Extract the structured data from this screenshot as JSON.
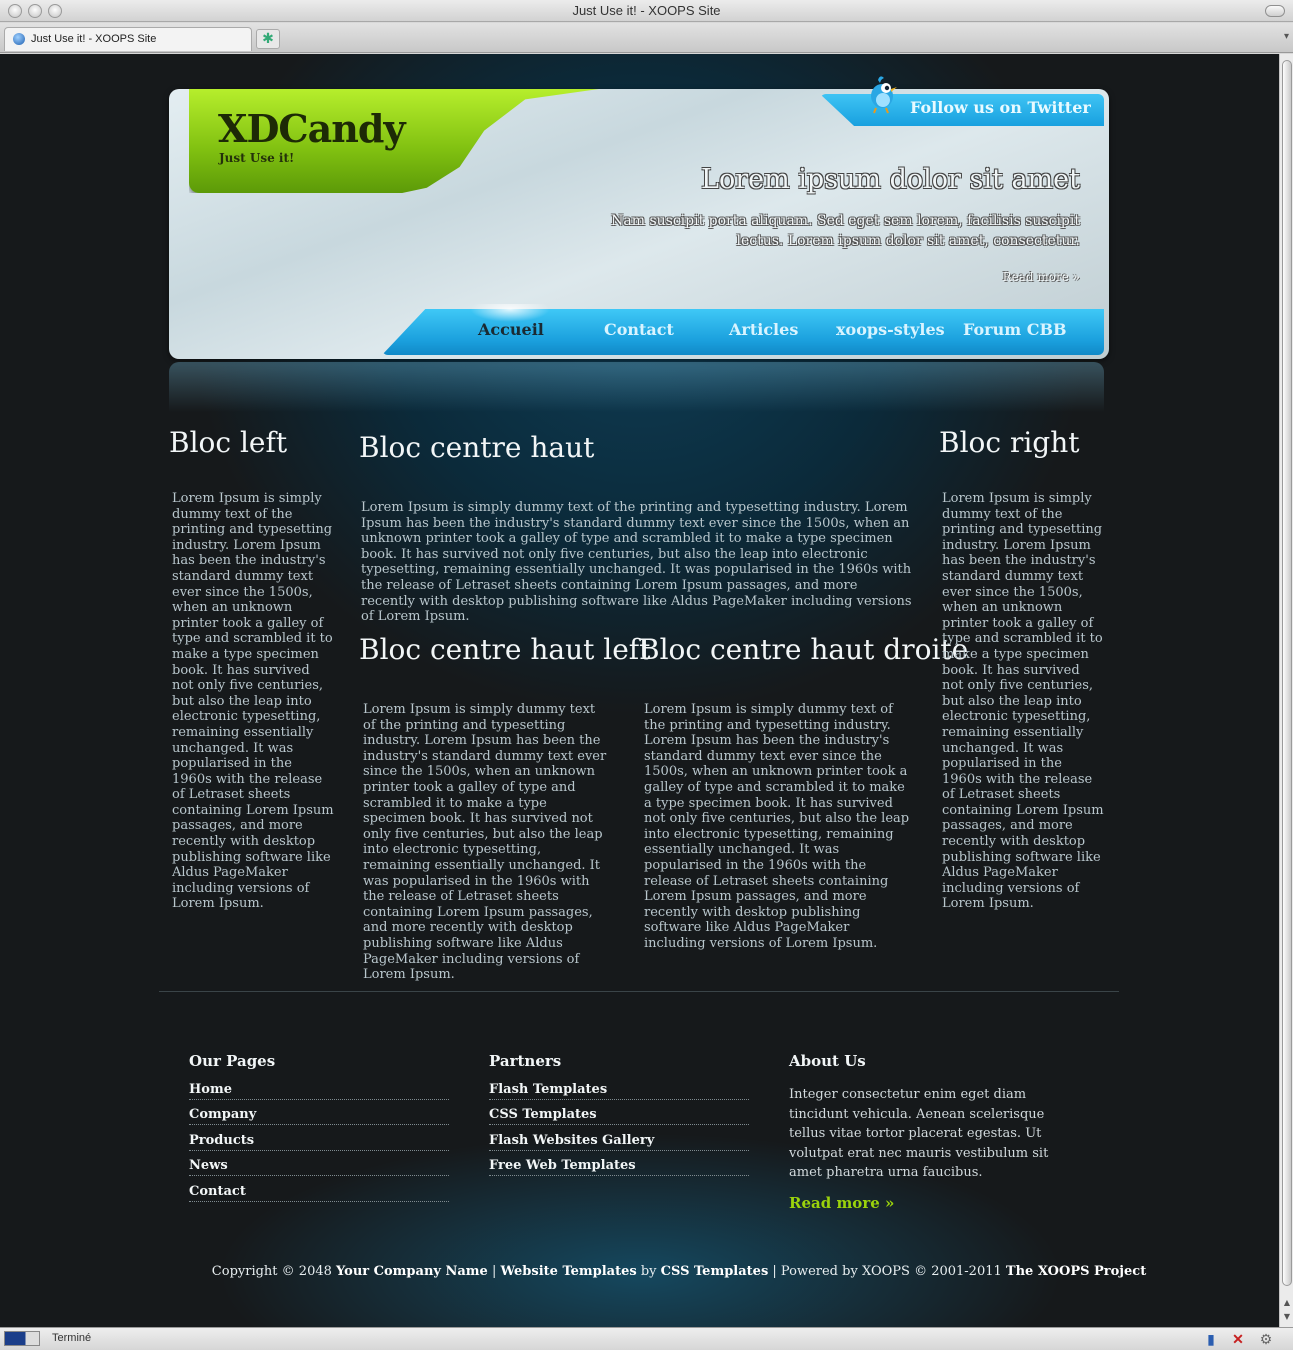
{
  "window": {
    "title": "Just Use it! - XOOPS Site"
  },
  "tabs": [
    {
      "label": "Just Use it! - XOOPS Site"
    }
  ],
  "status": {
    "text": "Terminé"
  },
  "header": {
    "logo": "XDCandy",
    "slogan": "Just Use it!",
    "twitter": "Follow us on Twitter",
    "hero_title": "Lorem ipsum dolor sit amet",
    "hero_text": "Nam suscipit porta aliquam. Sed eget sem lorem, facilisis suscipit lectus. Lorem ipsum dolor sit amet, consectetur.",
    "hero_more": "Read more »"
  },
  "nav": {
    "items": [
      {
        "label": "Accueil"
      },
      {
        "label": "Contact"
      },
      {
        "label": "Articles"
      },
      {
        "label": "xoops-styles"
      },
      {
        "label": "Forum CBB"
      }
    ]
  },
  "content": {
    "left": {
      "title": "Bloc left",
      "text": "Lorem Ipsum is simply dummy text of the printing and typesetting industry. Lorem Ipsum has been the industry's standard dummy text ever since the 1500s, when an unknown printer took a galley of type and scrambled it to make a type specimen book. It has survived not only five centuries, but also the leap into electronic typesetting, remaining essentially unchanged. It was popularised in the 1960s with the release of Letraset sheets containing Lorem Ipsum passages, and more recently with desktop publishing software like Aldus PageMaker including versions of Lorem Ipsum."
    },
    "center": {
      "title": "Bloc centre haut",
      "text": "Lorem Ipsum is simply dummy text of the printing and typesetting industry. Lorem Ipsum has been the industry's standard dummy text ever since the 1500s, when an unknown printer took a galley of type and scrambled it to make a type specimen book. It has survived not only five centuries, but also the leap into electronic typesetting, remaining essentially unchanged. It was popularised in the 1960s with the release of Letraset sheets containing Lorem Ipsum passages, and more recently with desktop publishing software like Aldus PageMaker including versions of Lorem Ipsum."
    },
    "center_left": {
      "title": "Bloc centre haut left",
      "text": "Lorem Ipsum is simply dummy text of the printing and typesetting industry. Lorem Ipsum has been the industry's standard dummy text ever since the 1500s, when an unknown printer took a galley of type and scrambled it to make a type specimen book. It has survived not only five centuries, but also the leap into electronic typesetting, remaining essentially unchanged. It was popularised in the 1960s with the release of Letraset sheets containing Lorem Ipsum passages, and more recently with desktop publishing software like Aldus PageMaker including versions of Lorem Ipsum."
    },
    "center_right": {
      "title": "Bloc centre haut droite",
      "text": "Lorem Ipsum is simply dummy text of the printing and typesetting industry. Lorem Ipsum has been the industry's standard dummy text ever since the 1500s, when an unknown printer took a galley of type and scrambled it to make a type specimen book. It has survived not only five centuries, but also the leap into electronic typesetting, remaining essentially unchanged. It was popularised in the 1960s with the release of Letraset sheets containing Lorem Ipsum passages, and more recently with desktop publishing software like Aldus PageMaker including versions of Lorem Ipsum."
    },
    "right": {
      "title": "Bloc right",
      "text": "Lorem Ipsum is simply dummy text of the printing and typesetting industry. Lorem Ipsum has been the industry's standard dummy text ever since the 1500s, when an unknown printer took a galley of type and scrambled it to make a type specimen book. It has survived not only five centuries, but also the leap into electronic typesetting, remaining essentially unchanged. It was popularised in the 1960s with the release of Letraset sheets containing Lorem Ipsum passages, and more recently with desktop publishing software like Aldus PageMaker including versions of Lorem Ipsum."
    }
  },
  "footer": {
    "pages": {
      "title": "Our Pages",
      "links": [
        "Home",
        "Company",
        "Products",
        "News",
        "Contact"
      ]
    },
    "partners": {
      "title": "Partners",
      "links": [
        "Flash Templates",
        "CSS Templates",
        "Flash Websites Gallery",
        "Free Web Templates"
      ]
    },
    "about": {
      "title": "About Us",
      "text": "Integer consectetur enim eget diam tincidunt vehicula. Aenean scelerisque tellus vitae tortor placerat egestas. Ut volutpat erat nec mauris vestibulum sit amet pharetra urna faucibus.",
      "more": "Read more »"
    },
    "copyright": {
      "prefix": "Copyright © 2048 ",
      "company": "Your Company Name",
      "sep1": " | ",
      "templates": "Website Templates",
      "by": " by ",
      "css": "CSS Templates",
      "powered": " | Powered by XOOPS © 2001-2011 ",
      "project": "The XOOPS Project"
    }
  },
  "colors": {
    "accent_green": "#9ad20c",
    "nav_blue": "#1a9fdd",
    "page_bg": "#1a1d1f",
    "text_muted": "#b9c7cd"
  },
  "icons": {
    "twitter": "bird-icon",
    "tab": "globe-favicon",
    "status_left": "flag-icon",
    "status_right": [
      "flag-icon",
      "close-icon",
      "gear-icon"
    ]
  }
}
